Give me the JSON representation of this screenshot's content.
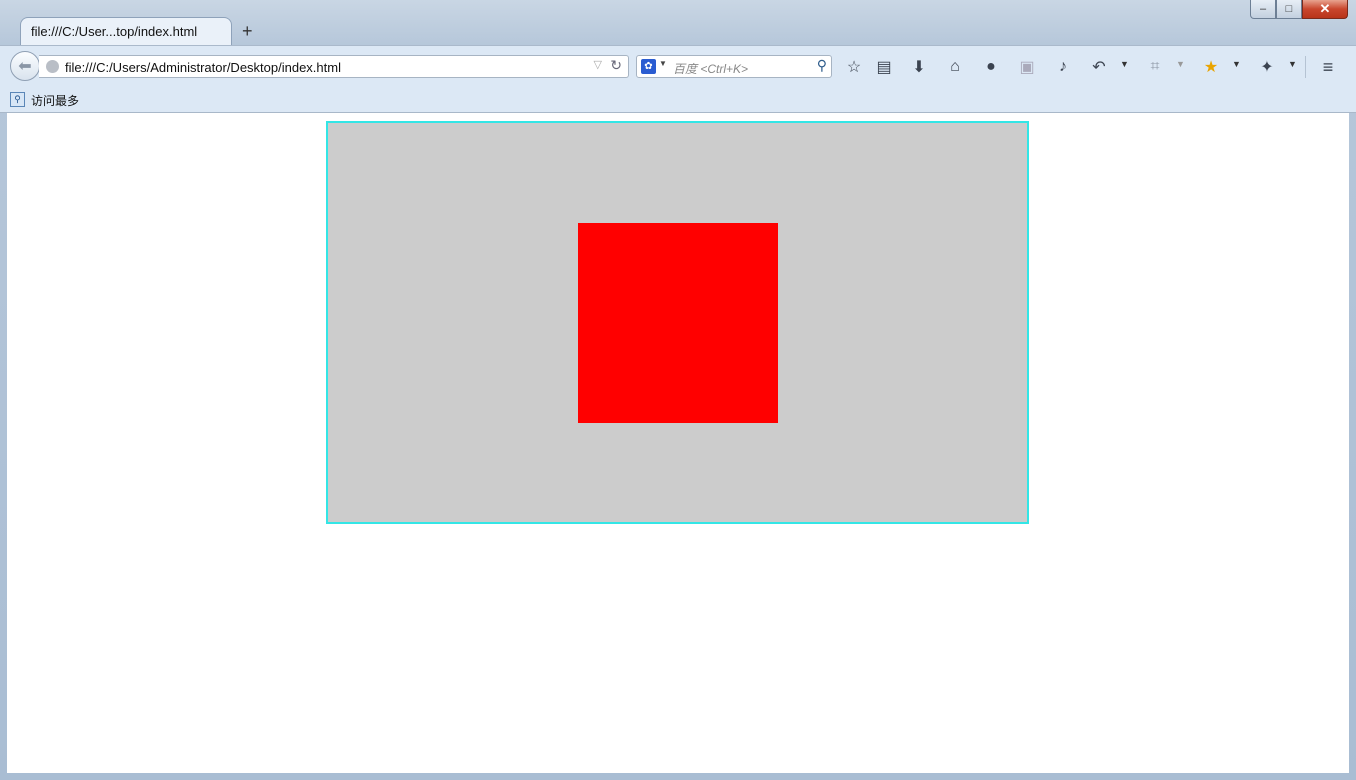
{
  "window": {
    "controls": {
      "minimize": "–",
      "maximize": "□",
      "close": "✕"
    }
  },
  "tab": {
    "title": "file:///C:/User...top/index.html",
    "new_tab": "+"
  },
  "nav": {
    "back_icon": "arrow-left-icon",
    "url": "file:///C:/Users/Administrator/Desktop/index.html",
    "search_placeholder": "百度 <Ctrl+K>",
    "search_engine": "baidu-icon"
  },
  "toolbar_icons": [
    "star-icon",
    "reading-list-icon",
    "download-icon",
    "home-icon",
    "chat-icon",
    "screenshot-icon",
    "speaker-icon",
    "undo-icon",
    "crop-icon",
    "favorites-icon",
    "addon-icon",
    "menu-icon"
  ],
  "bookmarks": {
    "item": "访问最多"
  },
  "page": {
    "outer_color": "#cccccc",
    "outer_border": "#33e6e6",
    "inner_color": "#ff0000"
  }
}
